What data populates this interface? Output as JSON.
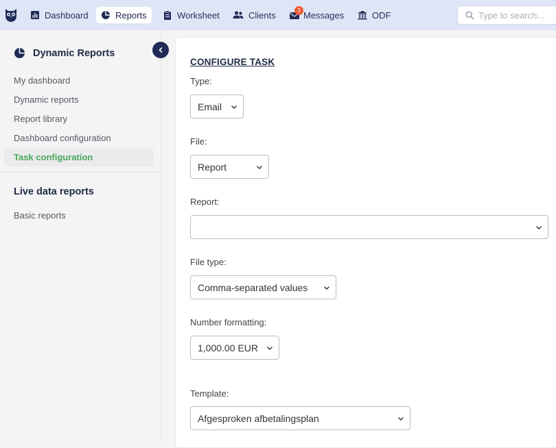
{
  "nav": {
    "items": [
      {
        "label": "Dashboard",
        "icon": "bar-chart-icon"
      },
      {
        "label": "Reports",
        "icon": "pie-chart-icon",
        "active": true
      },
      {
        "label": "Worksheet",
        "icon": "clipboard-icon"
      },
      {
        "label": "Clients",
        "icon": "users-icon"
      },
      {
        "label": "Messages",
        "icon": "envelope-icon",
        "badge": "3"
      },
      {
        "label": "ODF",
        "icon": "bank-icon"
      }
    ],
    "search_placeholder": "Type to search..."
  },
  "sidebar": {
    "title": "Dynamic Reports",
    "items": [
      {
        "label": "My dashboard"
      },
      {
        "label": "Dynamic reports"
      },
      {
        "label": "Report library"
      },
      {
        "label": "Dashboard configuration"
      },
      {
        "label": "Task configuration",
        "active": true
      }
    ],
    "section_title": "Live data reports",
    "section_items": [
      {
        "label": "Basic reports"
      }
    ]
  },
  "form": {
    "heading": "CONFIGURE TASK",
    "type": {
      "label": "Type:",
      "value": "Email"
    },
    "file": {
      "label": "File:",
      "value": "Report"
    },
    "report": {
      "label": "Report:",
      "value": ""
    },
    "file_type": {
      "label": "File type:",
      "value": "Comma-separated values"
    },
    "number_formatting": {
      "label": "Number formatting:",
      "value": "1,000.00 EUR"
    },
    "template": {
      "label": "Template:",
      "value": "Afgesproken afbetalingsplan"
    }
  },
  "colors": {
    "nav_bg": "#dde5f6",
    "accent_green": "#48a85a",
    "navy": "#1f2a55",
    "badge": "#f0582e"
  }
}
